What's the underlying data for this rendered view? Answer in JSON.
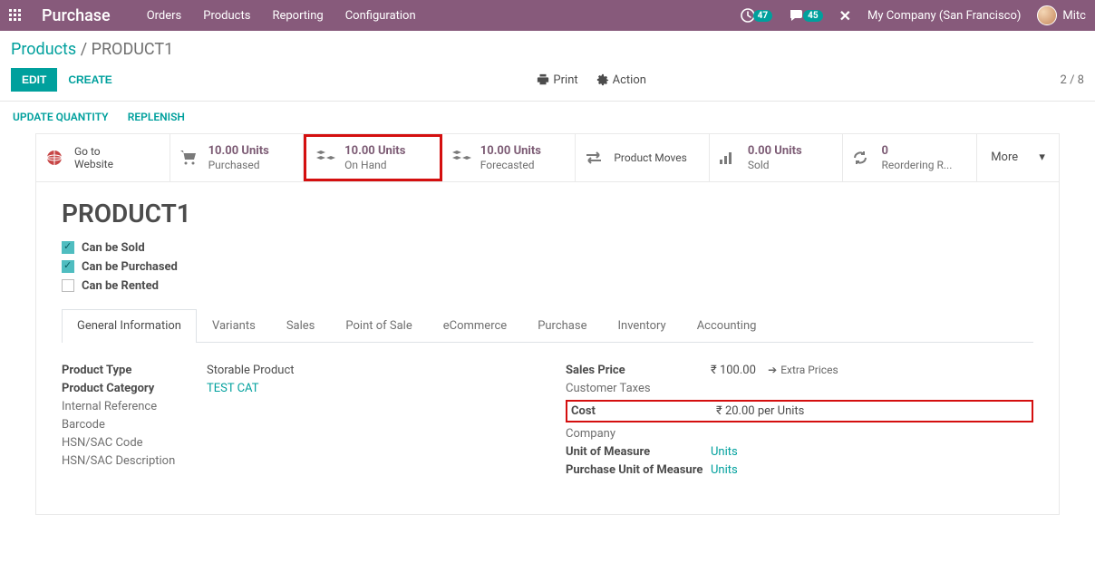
{
  "nav": {
    "brand": "Purchase",
    "menu": [
      "Orders",
      "Products",
      "Reporting",
      "Configuration"
    ],
    "clock_count": "47",
    "msg_count": "45",
    "company": "My Company (San Francisco)",
    "user": "Mitc"
  },
  "breadcrumb": {
    "parent": "Products",
    "current": "PRODUCT1"
  },
  "buttons": {
    "edit": "EDIT",
    "create": "CREATE",
    "print": "Print",
    "action": "Action",
    "update_qty": "UPDATE QUANTITY",
    "replenish": "REPLENISH"
  },
  "pager": "2 / 8",
  "smart": {
    "website": {
      "label": "Go to\nWebsite"
    },
    "purchased": {
      "value": "10.00 Units",
      "label": "Purchased"
    },
    "onhand": {
      "value": "10.00 Units",
      "label": "On Hand"
    },
    "forecast": {
      "value": "10.00 Units",
      "label": "Forecasted"
    },
    "moves": {
      "label": "Product Moves"
    },
    "sold": {
      "value": "0.00 Units",
      "label": "Sold"
    },
    "reorder": {
      "value": "0",
      "label": "Reordering R..."
    },
    "more": "More"
  },
  "product": {
    "name": "PRODUCT1",
    "can_sold": "Can be Sold",
    "can_purchased": "Can be Purchased",
    "can_rented": "Can be Rented"
  },
  "tabs": [
    "General Information",
    "Variants",
    "Sales",
    "Point of Sale",
    "eCommerce",
    "Purchase",
    "Inventory",
    "Accounting"
  ],
  "fields": {
    "product_type": {
      "label": "Product Type",
      "value": "Storable Product"
    },
    "category": {
      "label": "Product Category",
      "value": "TEST CAT"
    },
    "internal_ref": {
      "label": "Internal Reference"
    },
    "barcode": {
      "label": "Barcode"
    },
    "hsn_code": {
      "label": "HSN/SAC Code"
    },
    "hsn_desc": {
      "label": "HSN/SAC Description"
    },
    "sales_price": {
      "label": "Sales Price",
      "value": "₹ 100.00"
    },
    "extra_prices": "Extra Prices",
    "cust_tax": {
      "label": "Customer Taxes"
    },
    "cost": {
      "label": "Cost",
      "value": "₹ 20.00 per Units"
    },
    "company": {
      "label": "Company"
    },
    "uom": {
      "label": "Unit of Measure",
      "value": "Units"
    },
    "puom": {
      "label": "Purchase Unit of Measure",
      "value": "Units"
    }
  }
}
